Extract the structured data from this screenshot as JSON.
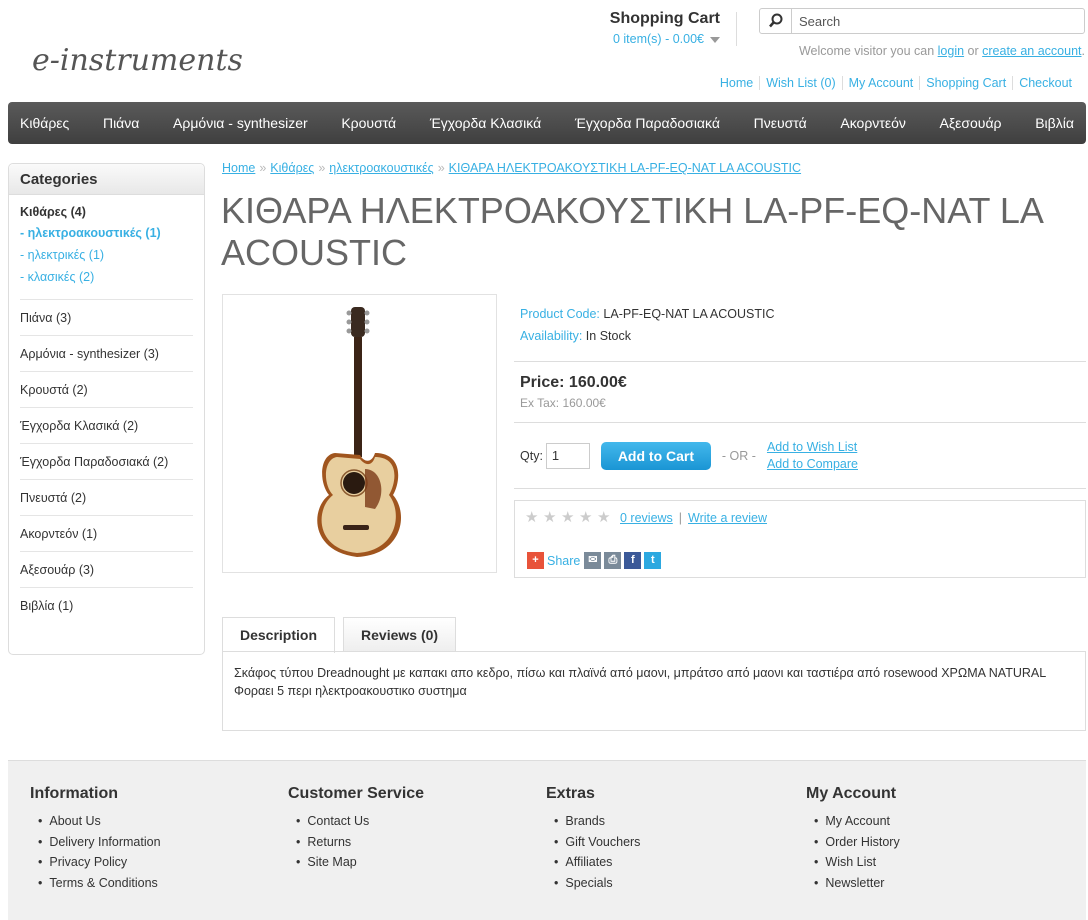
{
  "logo": {
    "text": "e-instruments"
  },
  "cart": {
    "title": "Shopping Cart",
    "summary": "0 item(s) - 0.00€"
  },
  "search": {
    "placeholder": "Search"
  },
  "welcome": {
    "prefix": "Welcome visitor you can ",
    "login": "login",
    "middle": " or ",
    "create": "create an account",
    "suffix": "."
  },
  "top_links": [
    "Home",
    "Wish List (0)",
    "My Account",
    "Shopping Cart",
    "Checkout"
  ],
  "menu": [
    "Κιθάρες",
    "Πιάνα",
    "Αρμόνια - synthesizer",
    "Κρουστά",
    "Έγχορδα Κλασικά",
    "Έγχορδα Παραδοσιακά",
    "Πνευστά",
    "Ακορντεόν",
    "Αξεσουάρ",
    "Βιβλία"
  ],
  "categories": {
    "heading": "Categories",
    "first": {
      "label": "Κιθάρες (4)",
      "subs": [
        "- ηλεκτροακουστικές (1)",
        "- ηλεκτρικές (1)",
        "- κλασικές (2)"
      ]
    },
    "items": [
      "Πιάνα (3)",
      "Αρμόνια - synthesizer (3)",
      "Κρουστά (2)",
      "Έγχορδα Κλασικά (2)",
      "Έγχορδα Παραδοσιακά (2)",
      "Πνευστά (2)",
      "Ακορντεόν (1)",
      "Αξεσουάρ (3)",
      "Βιβλία (1)"
    ]
  },
  "breadcrumb": [
    "Home",
    "Κιθάρες",
    "ηλεκτροακουστικές",
    "ΚΙΘΑΡΑ ΗΛΕΚΤΡΟΑΚΟΥΣΤΙΚΗ LA-PF-EQ-NAT LA ACOUSTIC"
  ],
  "breadcrumb_sep": "»",
  "product": {
    "title": "ΚΙΘΑΡΑ ΗΛΕΚΤΡΟΑΚΟΥΣΤΙΚΗ LA-PF-EQ-NAT LA ACOUSTIC",
    "code_label": "Product Code:",
    "code": "LA-PF-EQ-NAT LA ACOUSTIC",
    "availability_label": "Availability:",
    "availability": "In Stock",
    "price": "Price: 160.00€",
    "ex_tax": "Ex Tax: 160.00€",
    "qty_label": "Qty:",
    "qty_value": "1",
    "add_to_cart": "Add to Cart",
    "or": "- OR -",
    "wish": "Add to Wish List",
    "compare": "Add to Compare",
    "reviews_link": "0 reviews",
    "review_sep": "|",
    "write_review": "Write a review",
    "rating_stars": 0,
    "share": "Share"
  },
  "tabs": [
    "Description",
    "Reviews (0)"
  ],
  "description": "Σκάφος τύπου Dreadnought με καπακι απο κεδρο, πίσω και πλαϊνά από μαονι, μπράτσο από μαονι και ταστιέρα από rosewood ΧΡΩΜΑ NATURAL Φοραει 5 περι ηλεκτροακουστικο συστημα",
  "footer": [
    {
      "title": "Information",
      "links": [
        "About Us",
        "Delivery Information",
        "Privacy Policy",
        "Terms & Conditions"
      ]
    },
    {
      "title": "Customer Service",
      "links": [
        "Contact Us",
        "Returns",
        "Site Map"
      ]
    },
    {
      "title": "Extras",
      "links": [
        "Brands",
        "Gift Vouchers",
        "Affiliates",
        "Specials"
      ]
    },
    {
      "title": "My Account",
      "links": [
        "My Account",
        "Order History",
        "Wish List",
        "Newsletter"
      ]
    }
  ],
  "colors": {
    "accent": "#38b0e3",
    "menu_bg": "#4a4a4a",
    "button": "#1a95d4"
  }
}
